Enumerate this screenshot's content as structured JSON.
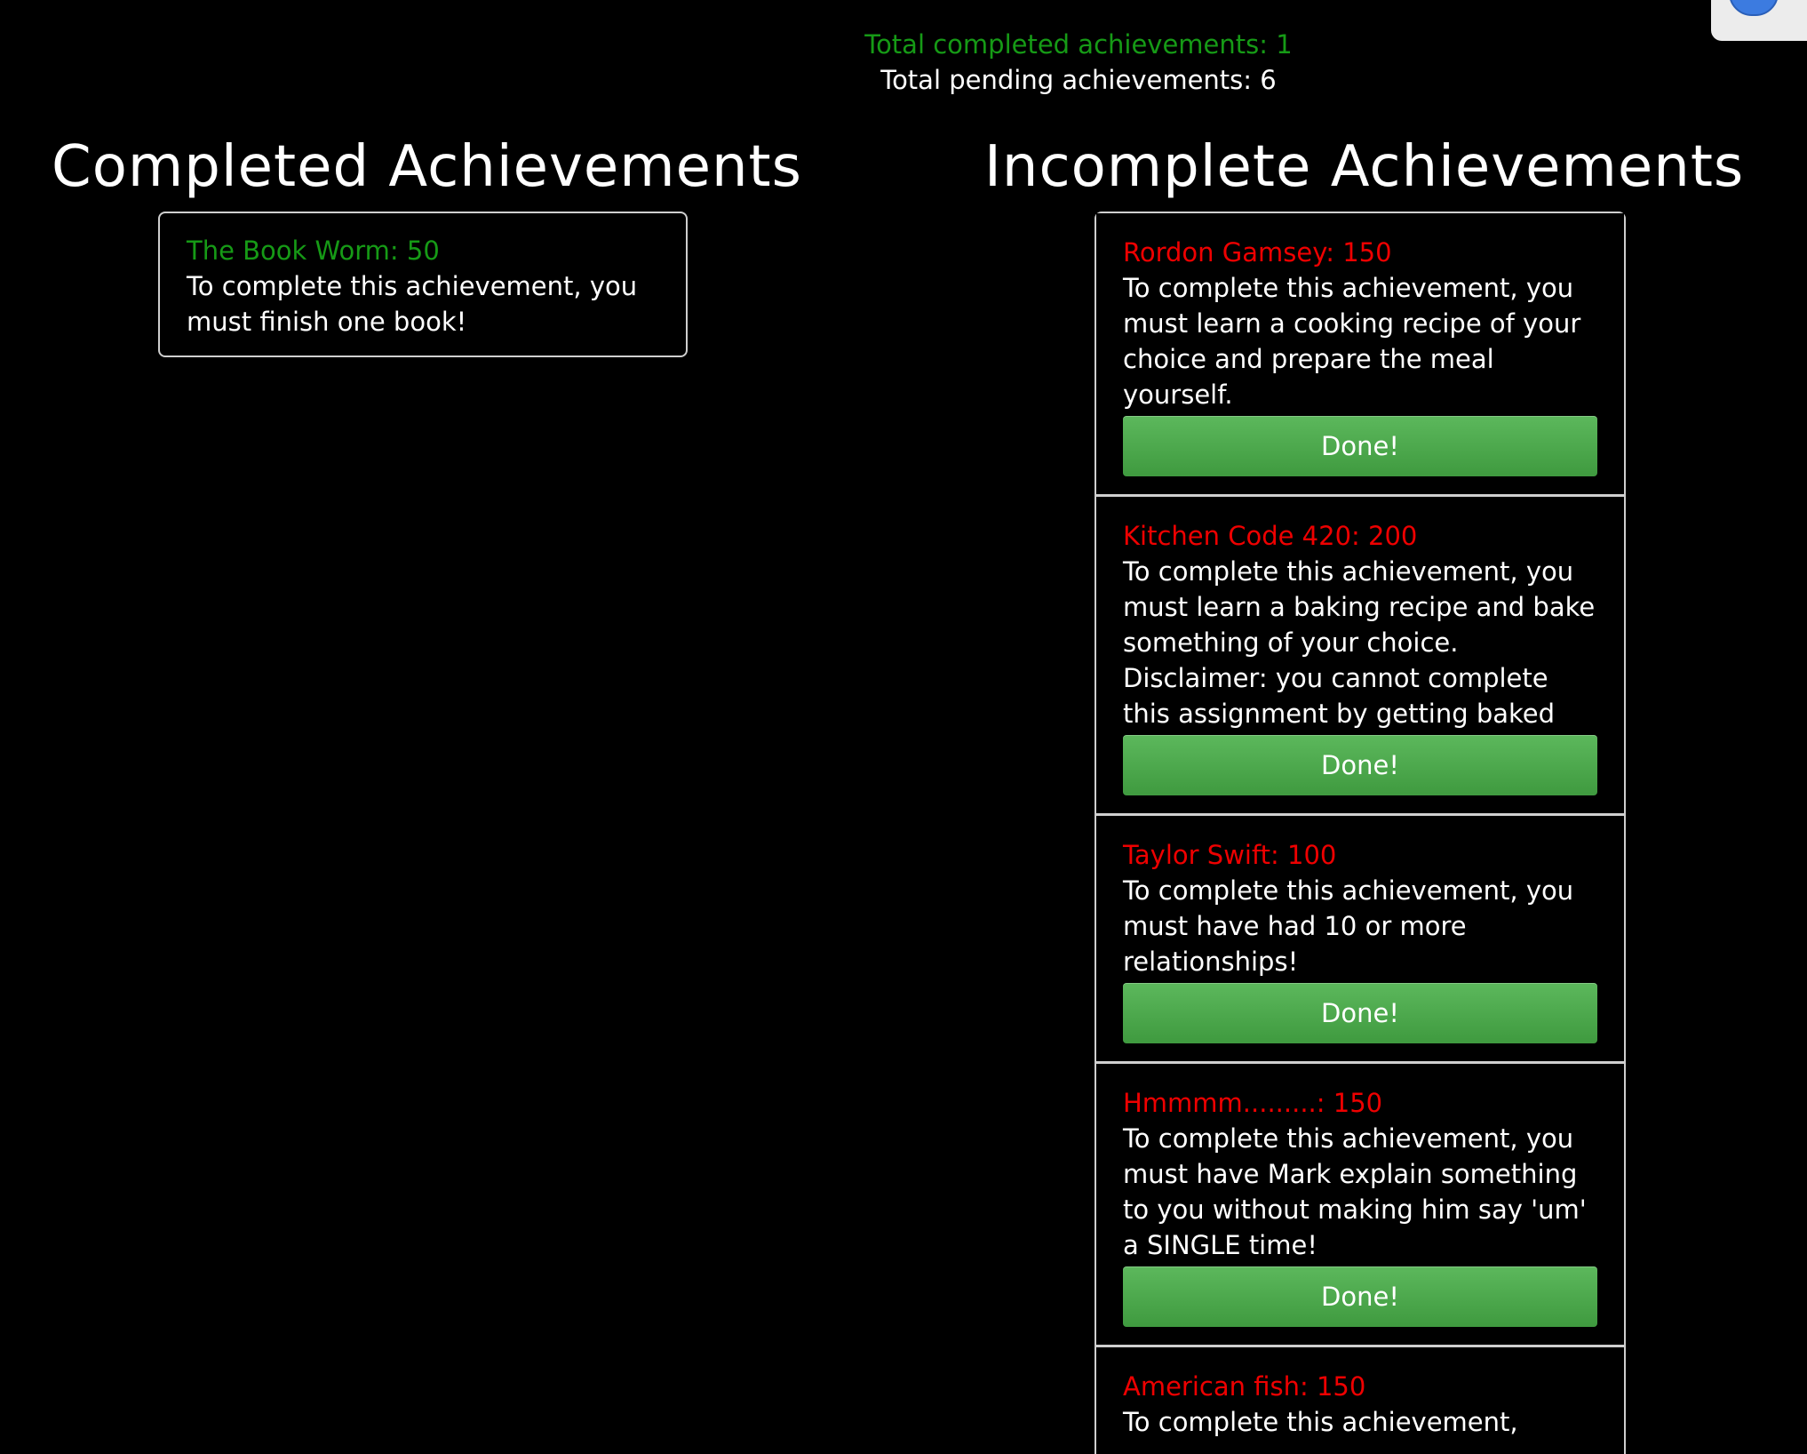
{
  "totals": {
    "completed": "Total completed achievements: 1",
    "pending": "Total pending achievements: 6"
  },
  "headings": {
    "completed": "Completed Achievements",
    "incomplete": "Incomplete Achievements"
  },
  "completed": [
    {
      "title": "The Book Worm: 50",
      "description": "To complete this achievement, you must finish one book!"
    }
  ],
  "incomplete": [
    {
      "title": "Rordon Gamsey: 150",
      "description": "To complete this achievement, you must learn a cooking recipe of your choice and prepare the meal yourself.",
      "button": "Done!"
    },
    {
      "title": "Kitchen Code 420: 200",
      "description": "To complete this achievement, you must learn a baking recipe and bake something of your choice. Disclaimer: you cannot complete this assignment by getting baked",
      "button": "Done!"
    },
    {
      "title": "Taylor Swift: 100",
      "description": "To complete this achievement, you must have had 10 or more relationships!",
      "button": "Done!"
    },
    {
      "title": "Hmmmm.........: 150",
      "description": "To complete this achievement, you must have Mark explain something to you without making him say 'um' a SINGLE time!",
      "button": "Done!"
    },
    {
      "title": "American fish: 150",
      "description": "To complete this achievement,"
    }
  ],
  "colors": {
    "completed_accent": "#169a16",
    "incomplete_accent": "#ee0000",
    "button": "#4cae4c",
    "background": "#000000"
  }
}
